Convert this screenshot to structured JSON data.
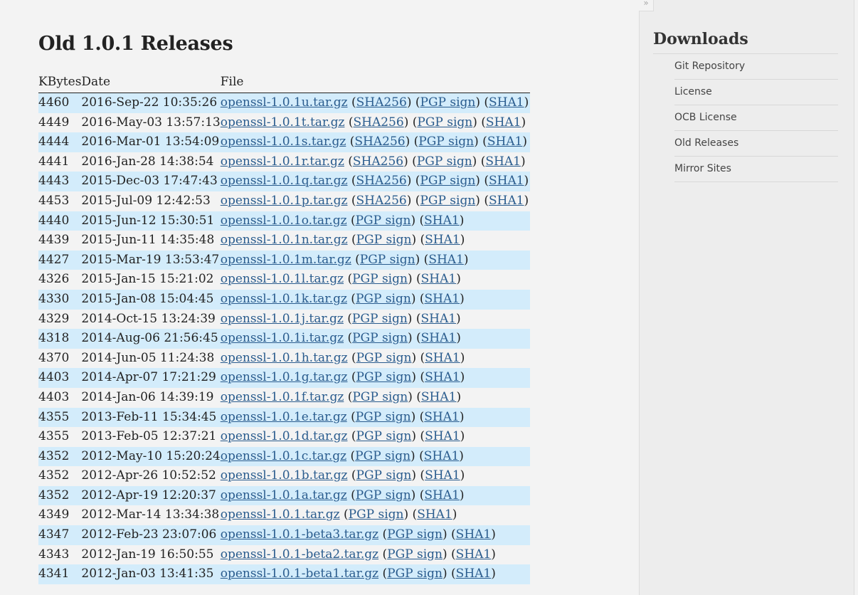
{
  "page": {
    "title": "Old 1.0.1 Releases",
    "columns": {
      "kbytes": "KBytes",
      "date": "Date",
      "file": "File"
    },
    "releases": [
      {
        "kb": "4460",
        "date": "2016-Sep-22 10:35:26",
        "file": "openssl-1.0.1u.tar.gz",
        "links": [
          "SHA256",
          "PGP sign",
          "SHA1"
        ]
      },
      {
        "kb": "4449",
        "date": "2016-May-03 13:57:13",
        "file": "openssl-1.0.1t.tar.gz",
        "links": [
          "SHA256",
          "PGP sign",
          "SHA1"
        ]
      },
      {
        "kb": "4444",
        "date": "2016-Mar-01 13:54:09",
        "file": "openssl-1.0.1s.tar.gz",
        "links": [
          "SHA256",
          "PGP sign",
          "SHA1"
        ]
      },
      {
        "kb": "4441",
        "date": "2016-Jan-28 14:38:54",
        "file": "openssl-1.0.1r.tar.gz",
        "links": [
          "SHA256",
          "PGP sign",
          "SHA1"
        ]
      },
      {
        "kb": "4443",
        "date": "2015-Dec-03 17:47:43",
        "file": "openssl-1.0.1q.tar.gz",
        "links": [
          "SHA256",
          "PGP sign",
          "SHA1"
        ]
      },
      {
        "kb": "4453",
        "date": "2015-Jul-09 12:42:53",
        "file": "openssl-1.0.1p.tar.gz",
        "links": [
          "SHA256",
          "PGP sign",
          "SHA1"
        ]
      },
      {
        "kb": "4440",
        "date": "2015-Jun-12 15:30:51",
        "file": "openssl-1.0.1o.tar.gz",
        "links": [
          "PGP sign",
          "SHA1"
        ]
      },
      {
        "kb": "4439",
        "date": "2015-Jun-11 14:35:48",
        "file": "openssl-1.0.1n.tar.gz",
        "links": [
          "PGP sign",
          "SHA1"
        ]
      },
      {
        "kb": "4427",
        "date": "2015-Mar-19 13:53:47",
        "file": "openssl-1.0.1m.tar.gz",
        "links": [
          "PGP sign",
          "SHA1"
        ]
      },
      {
        "kb": "4326",
        "date": "2015-Jan-15 15:21:02",
        "file": "openssl-1.0.1l.tar.gz",
        "links": [
          "PGP sign",
          "SHA1"
        ]
      },
      {
        "kb": "4330",
        "date": "2015-Jan-08 15:04:45",
        "file": "openssl-1.0.1k.tar.gz",
        "links": [
          "PGP sign",
          "SHA1"
        ]
      },
      {
        "kb": "4329",
        "date": "2014-Oct-15 13:24:39",
        "file": "openssl-1.0.1j.tar.gz",
        "links": [
          "PGP sign",
          "SHA1"
        ]
      },
      {
        "kb": "4318",
        "date": "2014-Aug-06 21:56:45",
        "file": "openssl-1.0.1i.tar.gz",
        "links": [
          "PGP sign",
          "SHA1"
        ]
      },
      {
        "kb": "4370",
        "date": "2014-Jun-05 11:24:38",
        "file": "openssl-1.0.1h.tar.gz",
        "links": [
          "PGP sign",
          "SHA1"
        ]
      },
      {
        "kb": "4403",
        "date": "2014-Apr-07 17:21:29",
        "file": "openssl-1.0.1g.tar.gz",
        "links": [
          "PGP sign",
          "SHA1"
        ]
      },
      {
        "kb": "4403",
        "date": "2014-Jan-06 14:39:19",
        "file": "openssl-1.0.1f.tar.gz",
        "links": [
          "PGP sign",
          "SHA1"
        ]
      },
      {
        "kb": "4355",
        "date": "2013-Feb-11 15:34:45",
        "file": "openssl-1.0.1e.tar.gz",
        "links": [
          "PGP sign",
          "SHA1"
        ]
      },
      {
        "kb": "4355",
        "date": "2013-Feb-05 12:37:21",
        "file": "openssl-1.0.1d.tar.gz",
        "links": [
          "PGP sign",
          "SHA1"
        ]
      },
      {
        "kb": "4352",
        "date": "2012-May-10 15:20:24",
        "file": "openssl-1.0.1c.tar.gz",
        "links": [
          "PGP sign",
          "SHA1"
        ]
      },
      {
        "kb": "4352",
        "date": "2012-Apr-26 10:52:52",
        "file": "openssl-1.0.1b.tar.gz",
        "links": [
          "PGP sign",
          "SHA1"
        ]
      },
      {
        "kb": "4352",
        "date": "2012-Apr-19 12:20:37",
        "file": "openssl-1.0.1a.tar.gz",
        "links": [
          "PGP sign",
          "SHA1"
        ]
      },
      {
        "kb": "4349",
        "date": "2012-Mar-14 13:34:38",
        "file": "openssl-1.0.1.tar.gz",
        "links": [
          "PGP sign",
          "SHA1"
        ]
      },
      {
        "kb": "4347",
        "date": "2012-Feb-23 23:07:06",
        "file": "openssl-1.0.1-beta3.tar.gz",
        "links": [
          "PGP sign",
          "SHA1"
        ]
      },
      {
        "kb": "4343",
        "date": "2012-Jan-19 16:50:55",
        "file": "openssl-1.0.1-beta2.tar.gz",
        "links": [
          "PGP sign",
          "SHA1"
        ]
      },
      {
        "kb": "4341",
        "date": "2012-Jan-03 13:41:35",
        "file": "openssl-1.0.1-beta1.tar.gz",
        "links": [
          "PGP sign",
          "SHA1"
        ]
      }
    ]
  },
  "sidebar": {
    "toggle_glyph": "»",
    "heading": "Downloads",
    "items": [
      "Git Repository",
      "License",
      "OCB License",
      "Old Releases",
      "Mirror Sites"
    ]
  },
  "colors": {
    "link": "#2a5c8e",
    "row_stripe": "#d3ecfb",
    "background": "#f3f3f3"
  }
}
